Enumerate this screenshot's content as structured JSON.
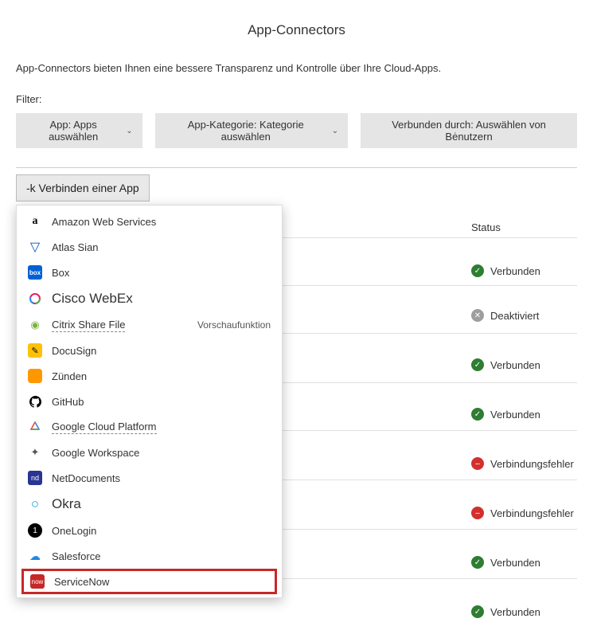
{
  "title": "App-Connectors",
  "subtitle": "App-Connectors bieten Ihnen eine bessere Transparenz und Kontrolle über Ihre Cloud-Apps.",
  "filters_label": "Filter:",
  "filters": {
    "app": "App: Apps auswählen",
    "category": "App-Kategorie: Kategorie auswählen",
    "connected_by": "Verbunden durch: Auswählen von Bėnutzern"
  },
  "connect_button": "-k Verbinden einer App",
  "dropdown": {
    "preview_tag": "Vorschaufunktion",
    "items": [
      {
        "label": "Amazon Web Services",
        "icon": "aws-icon"
      },
      {
        "label": "Atlas Sian",
        "icon": "atlassian-icon"
      },
      {
        "label": "Box",
        "icon": "box-icon"
      },
      {
        "label": "Cisco WebEx",
        "icon": "cisco-icon",
        "big": true
      },
      {
        "label": "Citrix Share File",
        "icon": "citrix-icon",
        "dotted": true,
        "tag": true
      },
      {
        "label": "DocuSign",
        "icon": "docusign-icon"
      },
      {
        "label": "Zünden",
        "icon": "zunden-icon"
      },
      {
        "label": "GitHub",
        "icon": "github-icon"
      },
      {
        "label": "Google Cloud Platform",
        "icon": "gcp-icon",
        "dotted": true
      },
      {
        "label": "Google Workspace",
        "icon": "google-workspace-icon"
      },
      {
        "label": "NetDocuments",
        "icon": "netdocuments-icon"
      },
      {
        "label": "Okra",
        "icon": "okta-icon",
        "big": true
      },
      {
        "label": "OneLogin",
        "icon": "onelogin-icon"
      },
      {
        "label": "Salesforce",
        "icon": "salesforce-icon"
      },
      {
        "label": "ServiceNow",
        "icon": "servicenow-icon",
        "highlight": true
      }
    ]
  },
  "status_header": "Status",
  "status_rows": [
    {
      "label": "Verbunden",
      "kind": "ok"
    },
    {
      "label": "Deaktiviert",
      "kind": "off"
    },
    {
      "label": "Verbunden",
      "kind": "ok"
    },
    {
      "label": "Verbunden",
      "kind": "ok"
    },
    {
      "label": "Verbindungsfehler",
      "kind": "err"
    },
    {
      "label": "Verbindungsfehler",
      "kind": "err"
    },
    {
      "label": "Verbunden",
      "kind": "ok"
    },
    {
      "label": "Verbunden",
      "kind": "ok"
    }
  ]
}
